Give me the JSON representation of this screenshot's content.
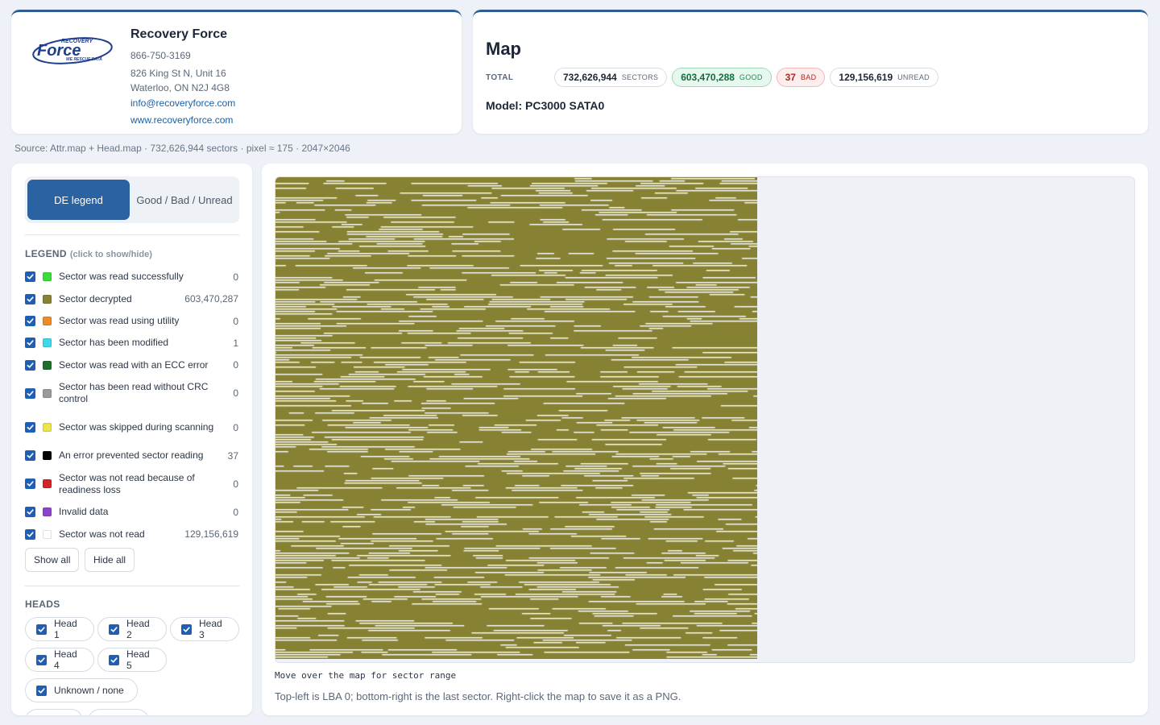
{
  "company": {
    "logo_text_top": "RECOVERY",
    "logo_text_main": "Force",
    "logo_text_bottom": "WE RESCUE DATA",
    "name": "Recovery Force",
    "phone": "866-750-3169",
    "address1": "826 King St N, Unit 16",
    "address2": "Waterloo, ON  N2J 4G8",
    "email": "info@recoveryforce.com",
    "website": "www.recoveryforce.com"
  },
  "summary": {
    "title": "Map",
    "total_label": "TOTAL",
    "sectors": {
      "value": "732,626,944",
      "unit": "SECTORS"
    },
    "good": {
      "value": "603,470,288",
      "unit": "GOOD"
    },
    "bad": {
      "value": "37",
      "unit": "BAD"
    },
    "unread": {
      "value": "129,156,619",
      "unit": "UNREAD"
    },
    "model": "Model: PC3000 SATA0"
  },
  "source_line": "Source: Attr.map + Head.map · 732,626,944 sectors · pixel ≈ 175 · 2047×2046",
  "sidebar": {
    "tabs": [
      {
        "label": "DE legend",
        "active": true
      },
      {
        "label": "Good / Bad / Unread",
        "active": false
      }
    ],
    "legend_title": "LEGEND",
    "legend_hint": "(click to show/hide)",
    "legend": [
      {
        "label": "Sector was read successfully",
        "count": "0",
        "color": "#3ddc3d",
        "checked": true
      },
      {
        "label": "Sector decrypted",
        "count": "603,470,287",
        "color": "#868133",
        "checked": true
      },
      {
        "label": "Sector was read using utility",
        "count": "0",
        "color": "#f08a24",
        "checked": true
      },
      {
        "label": "Sector has been modified",
        "count": "1",
        "color": "#3fd8e8",
        "checked": true
      },
      {
        "label": "Sector was read with an ECC error",
        "count": "0",
        "color": "#1f6e2c",
        "checked": true
      },
      {
        "label": "Sector has been read without CRC control",
        "count": "0",
        "color": "#9a9a9a",
        "checked": true
      },
      {
        "label": "Sector was skipped during scanning",
        "count": "0",
        "color": "#ece545",
        "checked": true
      },
      {
        "label": "An error prevented sector reading",
        "count": "37",
        "color": "#000000",
        "checked": true
      },
      {
        "label": "Sector was not read because of readiness loss",
        "count": "0",
        "color": "#d42424",
        "checked": true
      },
      {
        "label": "Invalid data",
        "count": "0",
        "color": "#8c44cc",
        "checked": true
      },
      {
        "label": "Sector was not read",
        "count": "129,156,619",
        "color": "#ffffff",
        "checked": true
      }
    ],
    "show_all_label": "Show all",
    "hide_all_label": "Hide all",
    "heads_title": "HEADS",
    "heads": [
      {
        "label": "Head 1",
        "checked": true
      },
      {
        "label": "Head 2",
        "checked": true
      },
      {
        "label": "Head 3",
        "checked": true
      },
      {
        "label": "Head 4",
        "checked": true
      },
      {
        "label": "Head 5",
        "checked": true
      },
      {
        "label": "Unknown / none",
        "checked": true
      }
    ]
  },
  "map": {
    "hover_text": "Move over the map for sector range",
    "help_text": "Top-left is LBA 0; bottom-right is the last sector. Right-click the map to save it as a PNG.",
    "fill_color": "#868133",
    "unread_color": "#ffffff",
    "empty_color": "#eef2f7",
    "good_fraction": 0.8237
  },
  "colors": {
    "accent": "#2a62a2",
    "checkbox": "#1d5fb4"
  }
}
